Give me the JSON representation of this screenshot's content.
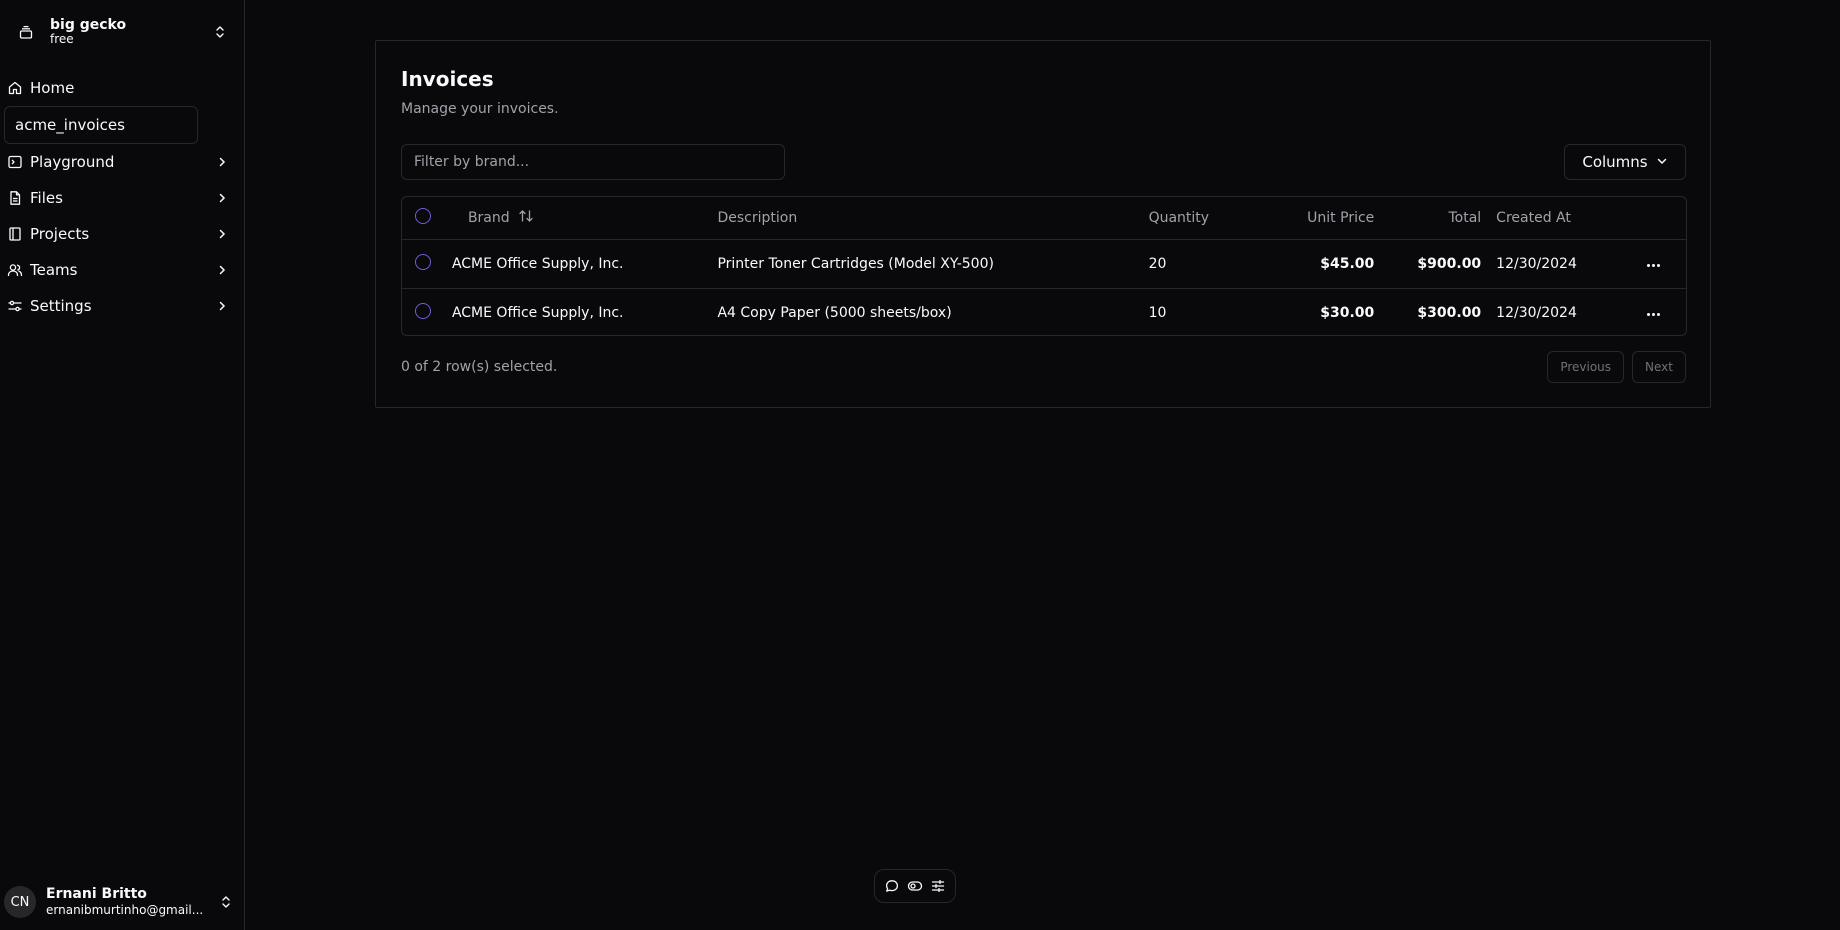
{
  "team": {
    "name": "big gecko",
    "plan": "free"
  },
  "nav": {
    "items": [
      {
        "label": "Home",
        "icon": "home-icon"
      },
      {
        "label": "acme_invoices"
      },
      {
        "label": "Playground",
        "icon": "terminal-icon"
      },
      {
        "label": "Files",
        "icon": "file-icon"
      },
      {
        "label": "Projects",
        "icon": "book-icon"
      },
      {
        "label": "Teams",
        "icon": "users-icon"
      },
      {
        "label": "Settings",
        "icon": "sliders-icon"
      }
    ]
  },
  "user": {
    "initials": "CN",
    "name": "Ernani Britto",
    "email": "ernanibmurtinho@gmail..."
  },
  "page": {
    "title": "Invoices",
    "subtitle": "Manage your invoices.",
    "filter_placeholder": "Filter by brand...",
    "columns_label": "Columns",
    "selection_text": "0 of 2 row(s) selected.",
    "previous_label": "Previous",
    "next_label": "Next"
  },
  "table": {
    "headers": {
      "brand": "Brand",
      "description": "Description",
      "quantity": "Quantity",
      "unit_price": "Unit Price",
      "total": "Total",
      "created_at": "Created At"
    },
    "rows": [
      {
        "brand": "ACME Office Supply, Inc.",
        "description": "Printer Toner Cartridges (Model XY-500)",
        "quantity": "20",
        "unit_price": "$45.00",
        "total": "$900.00",
        "created_at": "12/30/2024"
      },
      {
        "brand": "ACME Office Supply, Inc.",
        "description": "A4 Copy Paper (5000 sheets/box)",
        "quantity": "10",
        "unit_price": "$30.00",
        "total": "$300.00",
        "created_at": "12/30/2024"
      }
    ]
  },
  "colors": {
    "background": "#09090b",
    "border": "#27272a",
    "text": "#fafafa",
    "muted": "#a1a1aa",
    "accent": "#6d5fd6"
  }
}
